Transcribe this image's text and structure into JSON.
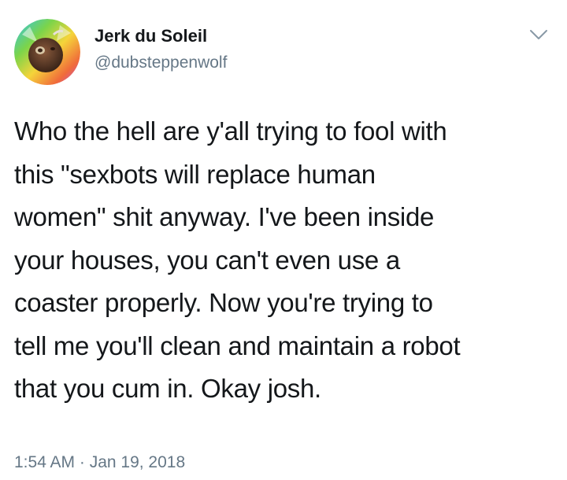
{
  "tweet": {
    "author": {
      "display_name": "Jerk du Soleil",
      "handle": "@dubsteppenwolf",
      "avatar_icon": "coconut-avatar-icon"
    },
    "menu_icon": "chevron-down-icon",
    "text": "Who the hell are y'all trying to fool with\nthis \"sexbots will replace human\nwomen\" shit anyway. I've been inside\nyour houses, you can't even use a\ncoaster properly. Now you're trying to\ntell me you'll clean and maintain a robot\nthat you cum in. Okay josh.",
    "timestamp": "1:54 AM · Jan 19, 2018"
  },
  "colors": {
    "text_primary": "#14171a",
    "text_secondary": "#657786",
    "background": "#ffffff"
  }
}
